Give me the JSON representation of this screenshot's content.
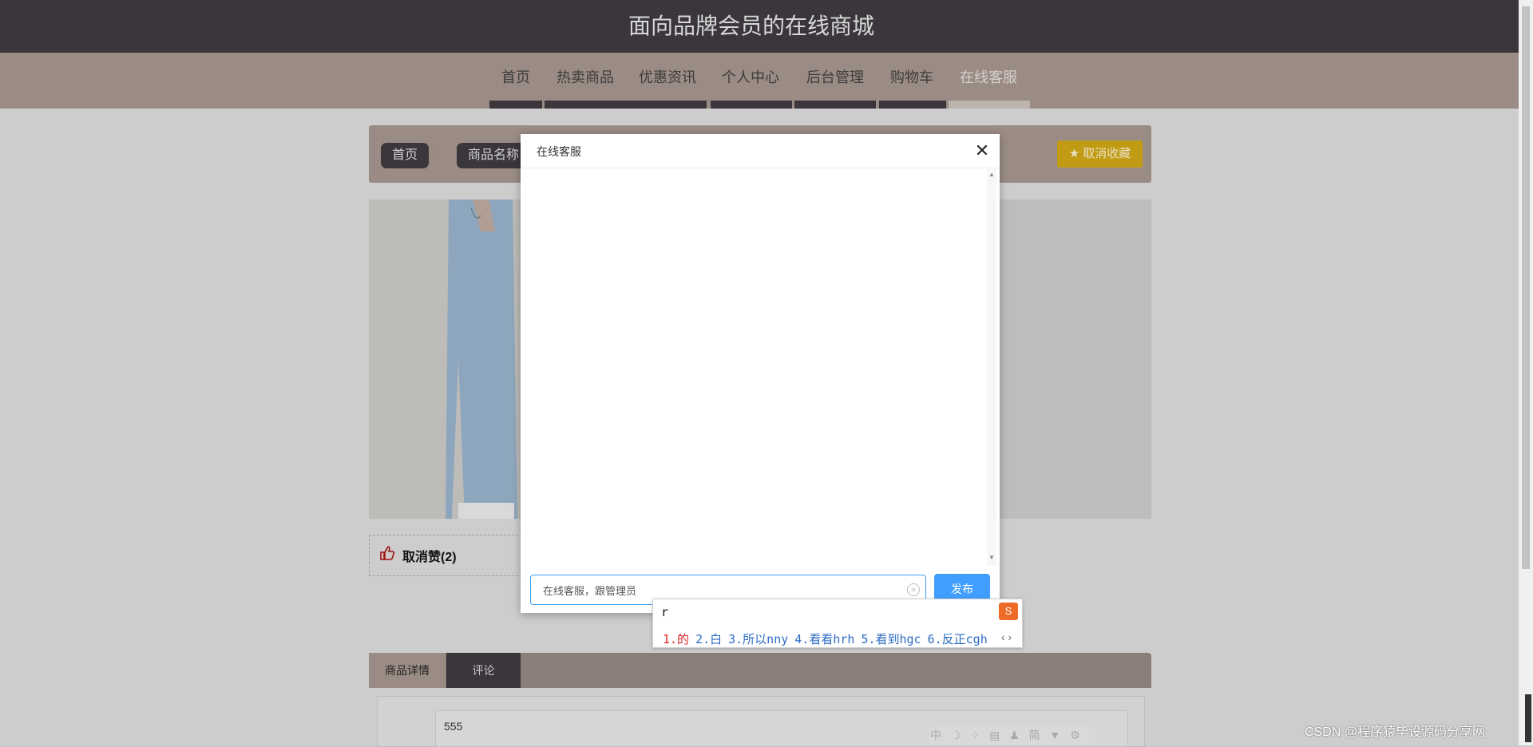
{
  "header": {
    "title": "面向品牌会员的在线商城"
  },
  "nav": {
    "items": [
      "首页",
      "热卖商品",
      "优惠资讯",
      "个人中心",
      "后台管理",
      "购物车",
      "在线客服"
    ]
  },
  "breadcrumb": {
    "home": "首页",
    "separator": "/",
    "current": "商品名称"
  },
  "favorite": {
    "label": "★ 取消收藏"
  },
  "like": {
    "label": "取消赞(2)"
  },
  "tabs": {
    "detail": "商品详情",
    "comment": "评论"
  },
  "detail": {
    "text": "555"
  },
  "modal": {
    "title": "在线客服",
    "close": "✕",
    "input_value": "在线客服，跟管理员",
    "send_label": "发布"
  },
  "ime": {
    "composition": "r",
    "candidates": [
      "1.的",
      "2.白",
      "3.所以nny",
      "4.看看hrh",
      "5.看到hgc",
      "6.反正cgh"
    ],
    "nav": "‹ ›"
  },
  "toolbar": {
    "icons": "中 ☽ ⁘ ▤ ♟ 简 ▼ ⚙"
  },
  "watermark": "CSDN @程序猿毕设源码分享网",
  "colors": {
    "header": "#3a363c",
    "nav": "#9a8c84",
    "accent": "#409eff",
    "fav": "#c29b14"
  }
}
